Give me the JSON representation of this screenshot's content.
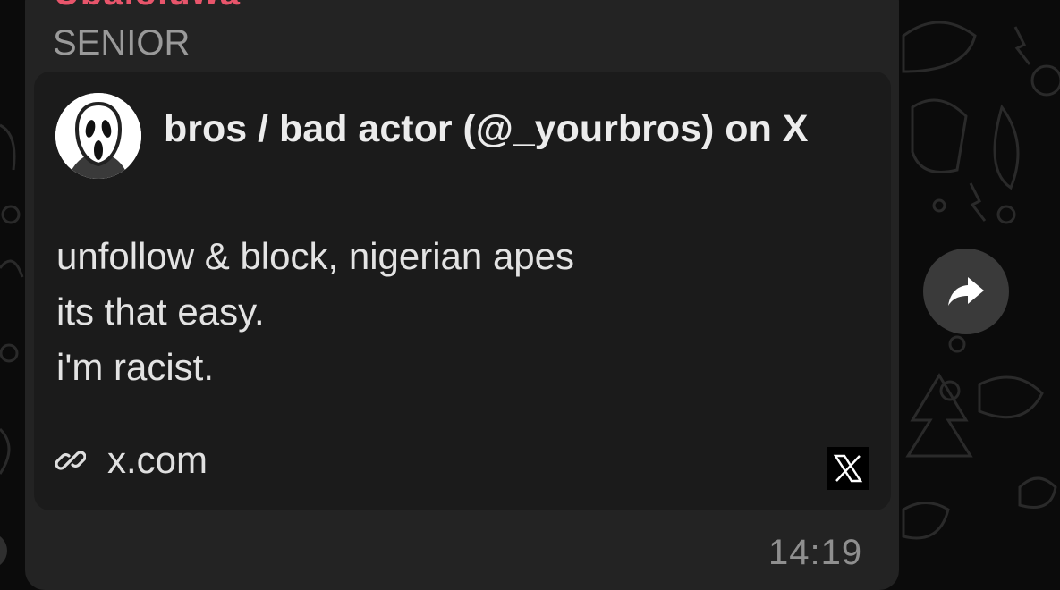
{
  "message": {
    "sender_name": "Ubaloluwa",
    "sender_title": "SENIOR",
    "timestamp": "14:19"
  },
  "link_preview": {
    "title": "bros / bad actor (@_yourbros) on X",
    "text_lines": [
      "unfollow & block, nigerian apes",
      "its that easy.",
      "i'm racist."
    ],
    "domain": "x.com",
    "avatar_icon": "ghostface-mask-icon",
    "site_logo_icon": "x-logo-icon"
  },
  "actions": {
    "forward_icon": "share-arrow-icon"
  },
  "colors": {
    "sender_name": "#e8556b",
    "bubble_bg": "#232323",
    "card_bg": "#1b1b1b",
    "chat_bg": "#0b0b0b"
  }
}
